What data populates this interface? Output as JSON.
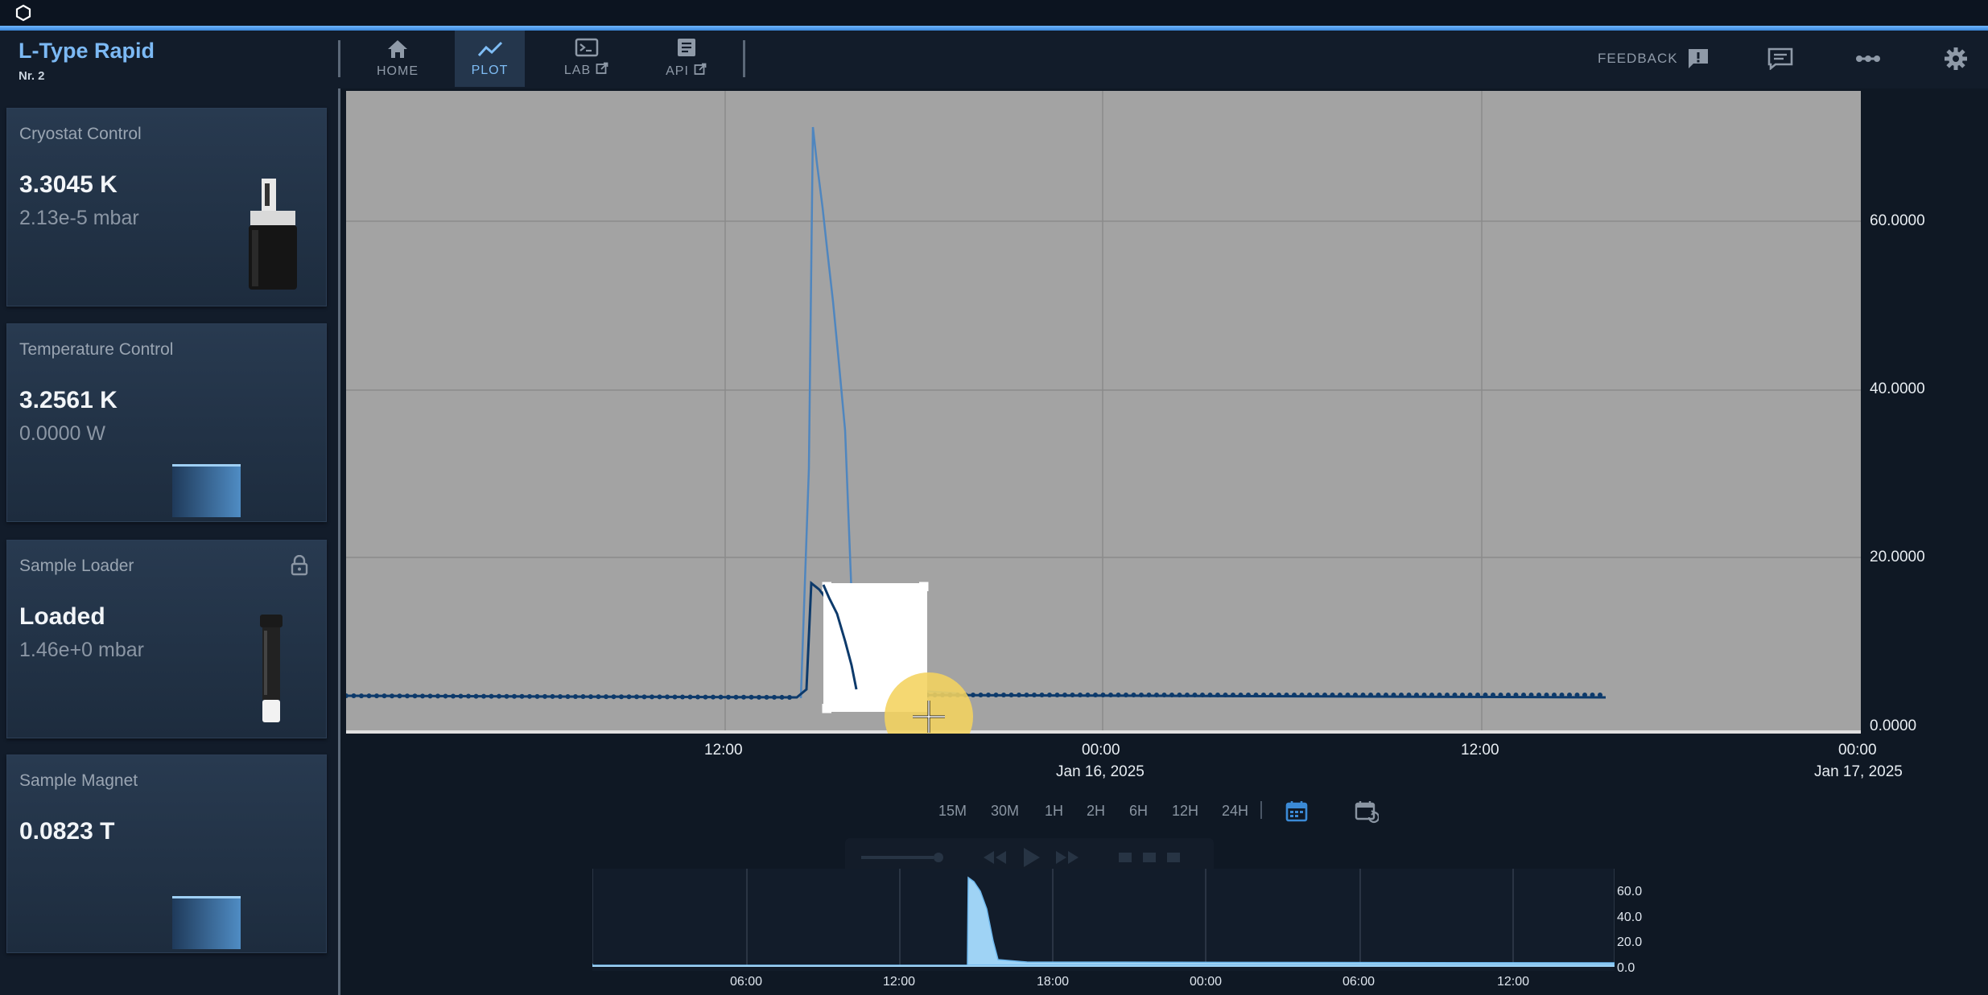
{
  "header": {
    "app_title": "L-Type Rapid",
    "app_subtitle": "Nr. 2",
    "nav": [
      {
        "label": "HOME",
        "icon": "home-icon",
        "active": false
      },
      {
        "label": "PLOT",
        "icon": "plot-icon",
        "active": true
      },
      {
        "label": "LAB",
        "icon": "terminal-icon",
        "external": true
      },
      {
        "label": "API",
        "icon": "document-icon",
        "external": true
      }
    ],
    "feedback_label": "FEEDBACK"
  },
  "sidebar": {
    "cards": [
      {
        "title": "Cryostat Control",
        "main": "3.3045 K",
        "sub": "2.13e-5 mbar",
        "image": "cryostat-image"
      },
      {
        "title": "Temperature Control",
        "main": "3.2561 K",
        "sub": "0.0000 W",
        "bar_level": 0.2
      },
      {
        "title": "Sample Loader",
        "main": "Loaded",
        "sub": "1.46e+0 mbar",
        "image": "sample-loader-image",
        "icon": "lock-icon"
      },
      {
        "title": "Sample Magnet",
        "main": "0.0823 T",
        "bar_level": 0.2
      }
    ]
  },
  "plot": {
    "x_ticks": [
      {
        "time": "12:00",
        "date": ""
      },
      {
        "time": "00:00",
        "date": "Jan 16, 2025"
      },
      {
        "time": "12:00",
        "date": ""
      },
      {
        "time": "00:00",
        "date": "Jan 17, 2025"
      }
    ],
    "y_ticks": [
      "60.0000",
      "40.0000",
      "20.0000",
      "0.0000"
    ],
    "range_buttons": [
      "15M",
      "30M",
      "1H",
      "2H",
      "6H",
      "12H",
      "24H"
    ],
    "colors": {
      "series_light": "#4f86bf",
      "series_dark": "#0d3a6b",
      "plot_bg": "#a3a3a3"
    }
  },
  "overview": {
    "x_ticks": [
      "06:00",
      "12:00",
      "18:00",
      "00:00",
      "06:00",
      "12:00"
    ],
    "y_ticks": [
      "60.0",
      "40.0",
      "20.0",
      "0.0"
    ],
    "color": "#9fd3f5"
  }
}
